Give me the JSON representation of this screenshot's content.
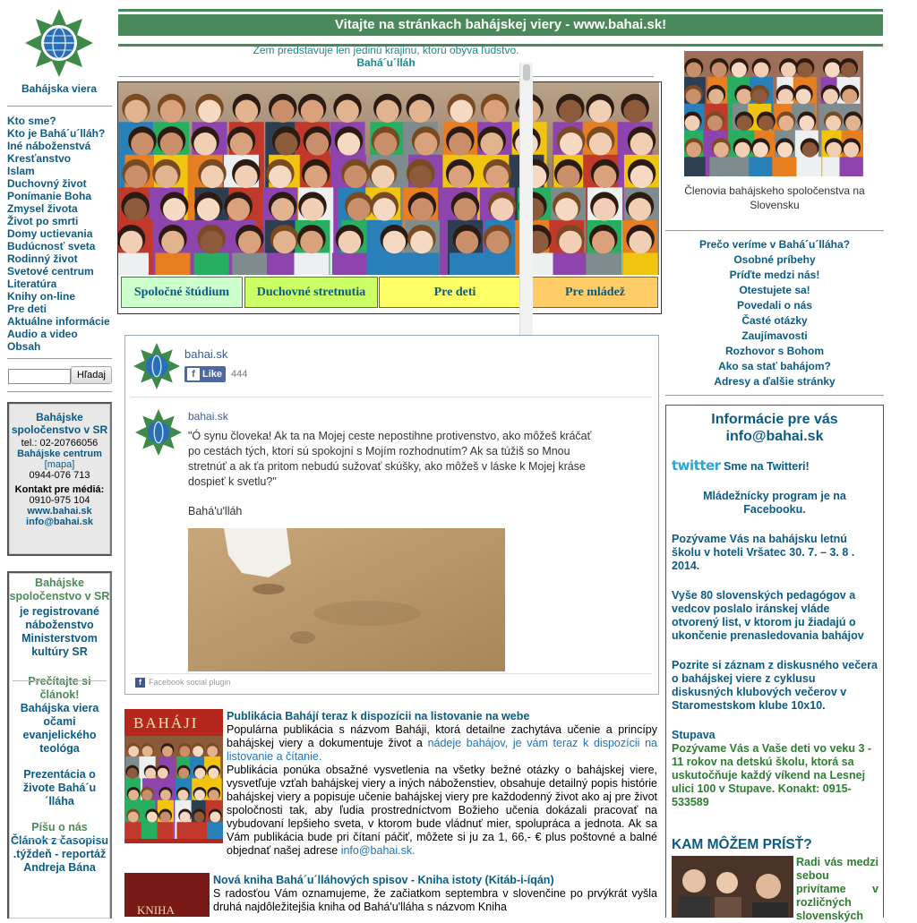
{
  "header": {
    "title": "Vitajte na stránkach bahájskej viery - www.bahai.sk!",
    "quote": "Zem predstavuje len jedinú krajinu, ktorú obýva ľudstvo.",
    "quote_author": "Bahá´u´lláh"
  },
  "left": {
    "site_name": "Bahájska viera",
    "nav": [
      "Kto sme?",
      "Kto je Bahá´u´lláh?",
      "Iné náboženstvá",
      "Kresťanstvo",
      "Islam",
      "Duchovný život",
      "Ponímanie Boha",
      "Zmysel života",
      "Život po smrti",
      "Domy uctievania",
      "Budúcnosť sveta",
      "Rodinný život",
      "Svetové centrum",
      "Literatúra",
      "Knihy on-line",
      "Pre deti",
      "Aktuálne informácie",
      "Audio a video",
      "Obsah"
    ],
    "search_button": "Hľadaj",
    "contact": {
      "title": "Bahájske spoločenstvo v SR",
      "tel": "tel.: 02-20766056",
      "center": "Bahájske centrum",
      "map": "[mapa]",
      "phone2": "0944-076 713",
      "media": "Kontakt pre médiá:",
      "phone3": "0910-975 104",
      "web": "www.bahai.sk",
      "email": "info@bahai.sk"
    },
    "box2": {
      "title": "Bahájske spoločenstvo v SR",
      "reg": "je registrované náboženstvo Ministerstvom kultúry SR",
      "read": "Prečítajte si článok!",
      "article": "Bahájska viera očami evanjelického teológa",
      "presentation": "Prezentácia o živote Bahá´u ´lláha",
      "about": "Píšu o nás",
      "article2": "Článok z časopisu .týždeň - reportáž Andreja Bána"
    }
  },
  "tabs": [
    "Spoločné štúdium",
    "Duchovné stretnutia",
    "Pre deti",
    "Pre mládež"
  ],
  "facebook": {
    "page": "bahai.sk",
    "like": "Like",
    "count": "444",
    "post_author": "bahai.sk",
    "post_text": "\"Ó synu človeka! Ak ta na Mojej ceste nepostihne protivenstvo, ako môžeš kráčať po cestách tých, ktorí sú spokojní s Mojím rozhodnutím? Ak sa túžiš so Mnou stretnúť a ak ťa pritom nebudú sužovať skúšky, ako môžeš v láske k Mojej kráse dospieť k svetlu?\"",
    "post_sign": "Bahá'u'lláh",
    "plugin": "Facebook social plugin"
  },
  "articles": [
    {
      "title": "Publikácia Bahájí teraz k dispozícii na listovanie na webe",
      "cover": "BAHÁJI",
      "p1_a": "Populárna publikácia s názvom Baháji, ktorá detailne zachytáva učenie a princípy bahájskej viery a dokumentuje život a ",
      "p1_link": "nádeje bahájov, je vám teraz k dispozícii na listovanie a čítanie.",
      "p2_a": "Publikácia ponúka obsažné vysvetlenia na všetky bežné otázky o bahájskej viere, vysvetľuje vzťah bahájskej viery a iných náboženstiev, obsahuje detailný popis histórie bahájskej viery a popisuje učenie bahájskej viery pre každodenný život ako aj pre život spoločnosti tak, aby ľudia prostredníctvom Božieho učenia dokázali pracovať na vybudovaní lepšieho sveta, v ktorom bude vládnuť mier, spolupráca a jednota. Ak sa Vám publikácia bude pri čítaní páčiť, môžete si ju za 1, 66,- € plus poštovné a balné objednať našej adrese ",
      "p2_link": "info@bahai.sk."
    },
    {
      "title": "Nová kniha Bahá´u´lláhových spisov - Kniha istoty (Kitáb-i-íqán)",
      "cover": "KNIHA",
      "text": "S radosťou Vám oznamujeme, že začiatkom septembra v slovenčine po prvýkrát vyšla druhá najdôležitejšia kniha od Bahá'u'lláha s názvom Kniha"
    }
  ],
  "right": {
    "caption": "Členovia bahájskeho spoločenstva na Slovensku",
    "links": [
      "Prečo veríme  v Bahá´u´lláha?",
      "Osobné príbehy",
      "Príďte medzi nás!",
      "Otestujete sa!",
      "Povedali o nás",
      "Časté otázky",
      "Zaujímavosti",
      "Rozhovor s Bohom",
      "Ako sa stať bahájom?",
      "Adresy a ďalšie stránky"
    ],
    "info_title": "Informácie pre vás",
    "info_email": "info@bahai.sk",
    "twitter_logo": "twitter",
    "twitter_text": "Sme na Twitteri!",
    "news": [
      "Mládežnícky program je na Facebooku.",
      "Pozývame Vás na bahájsku letnú školu v hoteli Vršatec 30. 7.  – 3. 8 . 2014.",
      "Vyše 80 slovenských pedagógov a vedcov poslalo iránskej vláde otvorený list, v ktorom ju žiadajú o ukončenie prenasledovania bahájov",
      "Pozrite si záznam z diskusného večera o bahájskej viere z cyklusu diskusných klubových večerov v Staromestskom klube 10x10."
    ],
    "stupava_title": "Stupava",
    "stupava_text": "Pozývame Vás a Vaše deti vo veku 3 - 11 rokov na detskú školu, ktorá sa uskutočňuje každý víkend na Lesnej ulici 100 v Stupave. Konakt: 0915-533589",
    "where": "KAM MÔŽEM PRÍSŤ?",
    "where_text": "Radi vás medzi sebou privítame v rozličných slovenských"
  },
  "colors": {
    "green_bar": "#4a8a5a",
    "link": "#0b5b85",
    "tab1": "#ccffcc",
    "tab2": "#ccff66",
    "tab3": "#ffff66",
    "tab4": "#ffcc66"
  }
}
